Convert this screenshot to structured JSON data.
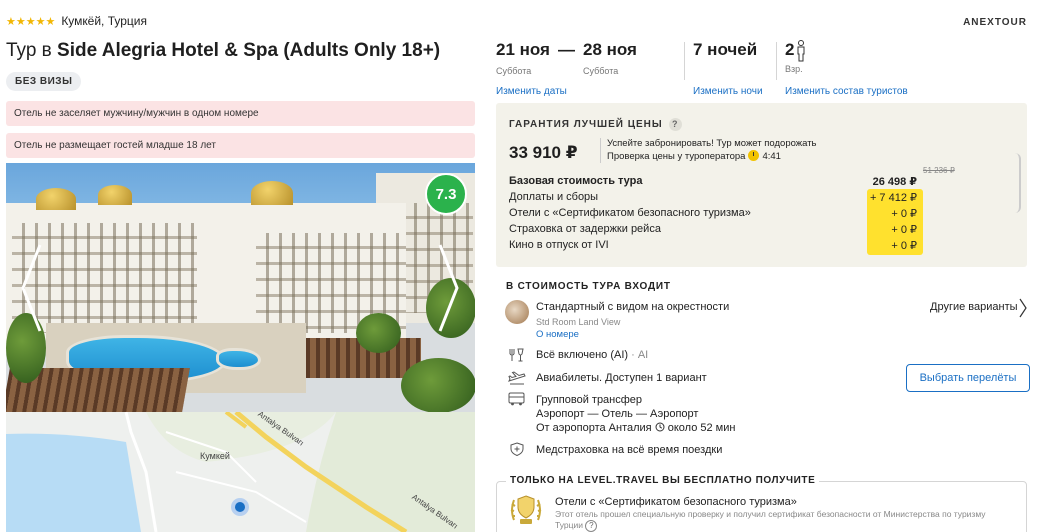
{
  "hotel": {
    "stars": "★★★★★",
    "location": "Кумкёй, Турция",
    "title_prefix": "Тур в",
    "title_name": "Side Alegria Hotel & Spa (Adults Only 18+)",
    "visa_badge": "БЕЗ ВИЗЫ",
    "warnings": [
      "Отель не заселяет мужчину/мужчин в одном номере",
      "Отель не размещает гостей младше 18 лет"
    ],
    "rating": "7.3"
  },
  "map": {
    "labels": [
      "Кумкей",
      "Antalya Bulvarı",
      "Antalya Bulvarı"
    ]
  },
  "operator": "ANEXTOUR",
  "dates": {
    "from": "21 ноя",
    "from_day": "Суббота",
    "dash": "—",
    "to": "28 ноя",
    "to_day": "Суббота",
    "change_label": "Изменить даты"
  },
  "nights": {
    "value": "7 ночей",
    "change_label": "Изменить ночи"
  },
  "tourists": {
    "count": "2",
    "label": "Взр.",
    "change_label": "Изменить состав туристов"
  },
  "price": {
    "guarantee": "ГАРАНТИЯ ЛУЧШЕЙ ЦЕНЫ",
    "total": "33 910 ₽",
    "note_line1": "Успейте забронировать! Тур может подорожать",
    "note_line2": "Проверка цены у туроператора",
    "timer": "4:41",
    "old_price": "51 236 ₽",
    "rows": [
      {
        "label": "Базовая стоимость тура",
        "value": "26 498 ₽"
      },
      {
        "label": "Доплаты и сборы",
        "value": "+ 7 412 ₽"
      },
      {
        "label": "Отели с «Сертификатом безопасного туризма»",
        "value": "+ 0 ₽"
      },
      {
        "label": "Страховка от задержки рейса",
        "value": "+ 0 ₽"
      },
      {
        "label": "Кино в отпуск от IVI",
        "value": "+ 0 ₽"
      }
    ]
  },
  "included": {
    "title": "В СТОИМОСТЬ ТУРА ВХОДИТ",
    "room": "Стандартный с видом на окрестности",
    "room_en": "Std Room Land View",
    "room_link": "О номере",
    "other_variants": "Другие варианты",
    "meal": "Всё включено (AI)",
    "meal_code": "· AI",
    "flights": "Авиабилеты. Доступен 1 вариант",
    "choose_flights": "Выбрать перелёты",
    "transfer": "Групповой трансфер",
    "transfer_route": "Аэропорт — Отель — Аэропорт",
    "transfer_time_prefix": "От аэропорта Анталия",
    "transfer_time": "около 52 мин",
    "insurance": "Медстраховка на всё время поездки"
  },
  "free": {
    "title": "ТОЛЬКО НА LEVEL.TRAVEL ВЫ БЕСПЛАТНО ПОЛУЧИТЕ",
    "cert_title": "Отели с «Сертификатом безопасного туризма»",
    "cert_sub": "Этот отель прошел специальную проверку и получил сертификат безопасности от Министерства по туризму Турции",
    "cert_q": "?"
  },
  "colors": {
    "link": "#1a6fc4",
    "rating": "#2bb24c",
    "highlight": "#ffe12e",
    "warning_bg": "#fbe3e4"
  }
}
